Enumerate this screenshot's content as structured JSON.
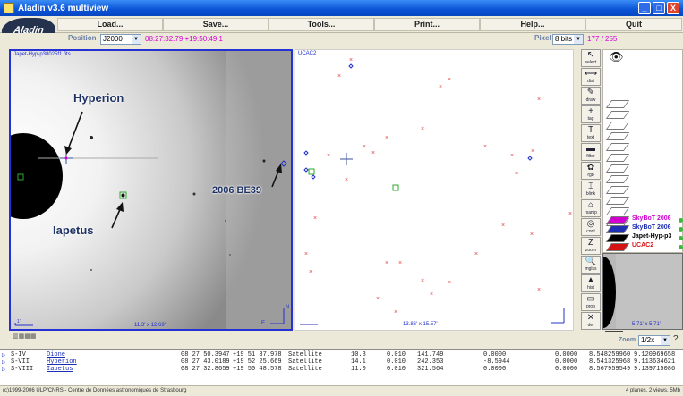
{
  "window": {
    "title": "Aladin v3.6 multiview",
    "minimize": "_",
    "maximize": "□",
    "close": "X"
  },
  "menu": {
    "load": "Load...",
    "save": "Save...",
    "tools": "Tools...",
    "print": "Print...",
    "help": "Help...",
    "quit": "Quit"
  },
  "logo": "Aladin",
  "position": {
    "label": "Position",
    "frame": "J2000",
    "coords": "08:27:32.79 +19:50:49.1"
  },
  "pixel": {
    "label": "Pixel",
    "mode": "8 bits",
    "value": "177 / 255"
  },
  "view1": {
    "filename": "Japet-Hyp-p38025f1.fits",
    "scale": "11.3' x 12.69'"
  },
  "view2": {
    "filename": "UCAC2",
    "scale": "13.86' x 15.57'"
  },
  "annotations": {
    "hyperion": "Hyperion",
    "iapetus": "Iapetus",
    "be39": "2006 BE39"
  },
  "tools": [
    {
      "g": "↖",
      "l": "select"
    },
    {
      "g": "⟷",
      "l": "dist"
    },
    {
      "g": "✎",
      "l": "draw"
    },
    {
      "g": "+",
      "l": "tag"
    },
    {
      "g": "T",
      "l": "text"
    },
    {
      "g": "▬",
      "l": "filter"
    },
    {
      "g": "✿",
      "l": "rgb"
    },
    {
      "g": "⌶",
      "l": "blink"
    },
    {
      "g": "⌂",
      "l": "rsamp"
    },
    {
      "g": "◎",
      "l": "cont"
    },
    {
      "g": "Z",
      "l": "zoom"
    },
    {
      "g": "🔍",
      "l": "mglss"
    },
    {
      "g": "▲",
      "l": "hist"
    },
    {
      "g": "▭",
      "l": "prop"
    },
    {
      "g": "✕",
      "l": "del"
    }
  ],
  "layers": [
    {
      "name": "SkyBoT 2006",
      "color": "#d100d1"
    },
    {
      "name": "SkyBoT 2006",
      "color": "#1f2fb3"
    },
    {
      "name": "Japet-Hyp-p3",
      "color": "#000000"
    },
    {
      "name": "UCAC2",
      "color": "#d41414"
    }
  ],
  "thumb": {
    "scale": "5.71' x 5.71'"
  },
  "zoom": {
    "label": "Zoom",
    "value": "1/2x"
  },
  "table": {
    "rows": [
      {
        "type": "S-IV",
        "name": "Dione",
        "ra": "08 27 50.3947",
        "dec": "+19 51 37.978",
        "class": "Satellite",
        "mag": "10.3",
        "err": "0.010",
        "dist": "141.749",
        "v1": "0.0000",
        "v2": "0.0000",
        "v3": "8.548259960",
        "v4": "9.120969658"
      },
      {
        "type": "S-VII",
        "name": "Hyperion",
        "ra": "08 27 43.0189",
        "dec": "+19 52 25.669",
        "class": "Satellite",
        "mag": "14.1",
        "err": "0.010",
        "dist": "242.353",
        "v1": "-8.5944",
        "v2": "0.0000",
        "v3": "8.541325968",
        "v4": "9.113634621"
      },
      {
        "type": "S-VIII",
        "name": "Iapetus",
        "ra": "08 27 32.8659",
        "dec": "+19 50 48.578",
        "class": "Satellite",
        "mag": "11.0",
        "err": "0.010",
        "dist": "321.564",
        "v1": "0.0000",
        "v2": "0.0000",
        "v3": "8.567959549",
        "v4": "9.139715086"
      }
    ]
  },
  "status": {
    "left": "(c)1999-2006 ULP/CNRS - Centre de Données astronomiques de Strasbourg",
    "right": "4 planes, 2 views, 5Mb"
  }
}
